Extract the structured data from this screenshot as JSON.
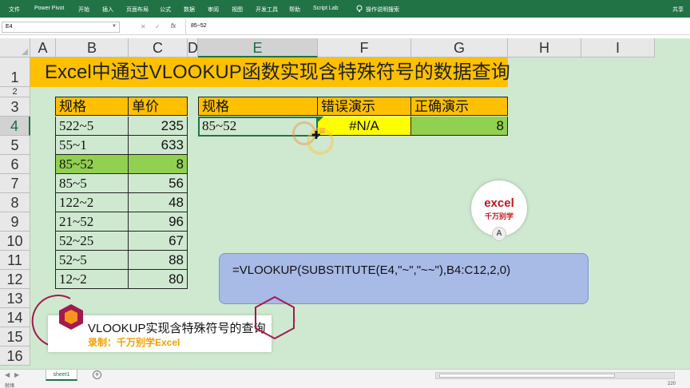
{
  "ribbon": {
    "tabs": [
      "文件",
      "Power Pivot",
      "开始",
      "插入",
      "页面布局",
      "公式",
      "数据",
      "审阅",
      "视图",
      "开发工具",
      "帮助",
      "Script Lab"
    ],
    "tell_me": "操作说明搜索",
    "share": "共享"
  },
  "formula_bar": {
    "name_box": "E4",
    "cancel": "✕",
    "enter": "✓",
    "fx": "fx",
    "content": "85~52"
  },
  "columns": [
    "A",
    "B",
    "C",
    "D",
    "E",
    "F",
    "G",
    "H",
    "I"
  ],
  "rows": [
    "1",
    "2",
    "3",
    "4",
    "5",
    "6",
    "7",
    "8",
    "9",
    "10",
    "11",
    "12",
    "13",
    "14",
    "15",
    "16"
  ],
  "title": "Excel中通过VLOOKUP函数实现含特殊符号的数据查询",
  "table1": {
    "headers": [
      "规格",
      "单价"
    ],
    "rows": [
      [
        "522~5",
        "235"
      ],
      [
        "55~1",
        "633"
      ],
      [
        "85~52",
        "8"
      ],
      [
        "85~5",
        "56"
      ],
      [
        "122~2",
        "48"
      ],
      [
        "21~52",
        "96"
      ],
      [
        "52~25",
        "67"
      ],
      [
        "52~5",
        "88"
      ],
      [
        "12~2",
        "80"
      ]
    ]
  },
  "table2": {
    "headers": [
      "规格",
      "错误演示",
      "正确演示"
    ],
    "row": [
      "85~52",
      "#N/A",
      "8"
    ]
  },
  "formula_note": "=VLOOKUP(SUBSTITUTE(E4,\"~\",\"~~\"),B4:C12,2,0)",
  "logo": {
    "line1": "excel",
    "line2": "千万别学",
    "badge": "A"
  },
  "caption": {
    "title": "VLOOKUP实现含特殊符号的查询",
    "subtitle": "录制：千万别学Excel"
  },
  "sheets": {
    "active": "sheet1",
    "add": "+"
  },
  "status": {
    "left": "就绪",
    "zoom": "220"
  },
  "colors": {
    "accent": "#217346",
    "header": "#ffc000",
    "highlight": "#92d050",
    "error": "#ffff00",
    "grid_bg": "#cfe9d0",
    "note_bg": "#a8bae6"
  }
}
